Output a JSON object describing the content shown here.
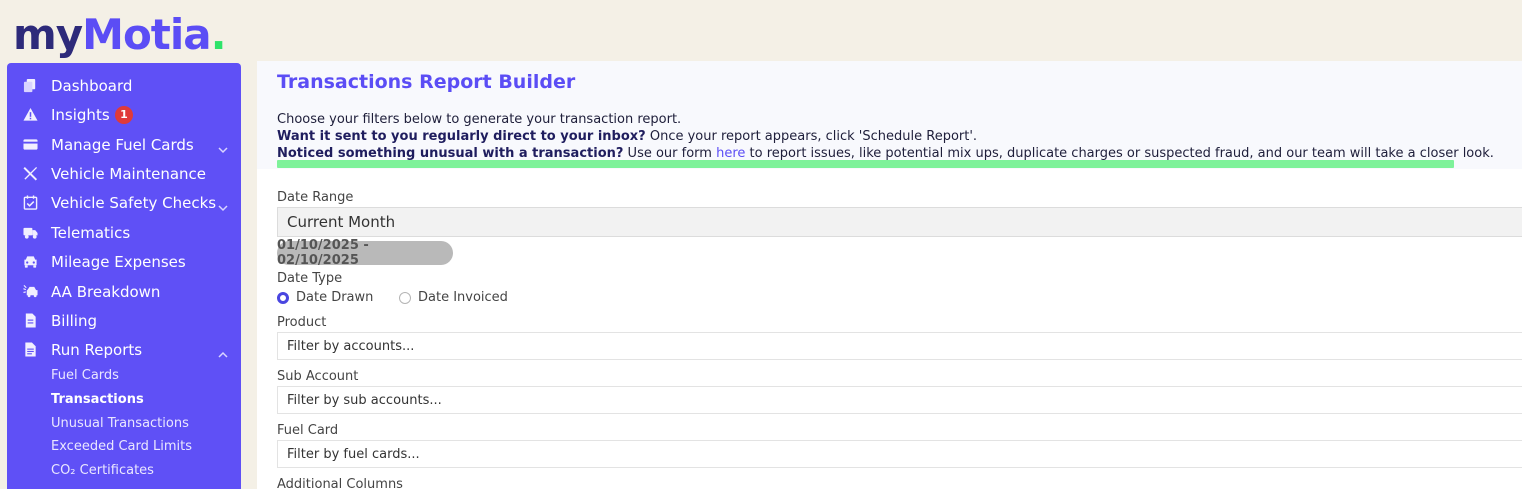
{
  "brand": {
    "logo_prefix": "my",
    "logo_main": "Motia",
    "logo_dot": "."
  },
  "sidebar": {
    "items": [
      {
        "label": "Dashboard",
        "icon": "copy-icon"
      },
      {
        "label": "Insights",
        "icon": "warning-icon",
        "badge": "1"
      },
      {
        "label": "Manage Fuel Cards",
        "icon": "credit-card-icon",
        "expandable": true
      },
      {
        "label": "Vehicle Maintenance",
        "icon": "tools-icon"
      },
      {
        "label": "Vehicle Safety Checks",
        "icon": "calendar-check-icon",
        "expandable": true
      },
      {
        "label": "Telematics",
        "icon": "truck-icon"
      },
      {
        "label": "Mileage Expenses",
        "icon": "car-icon"
      },
      {
        "label": "AA Breakdown",
        "icon": "car-crash-icon"
      },
      {
        "label": "Billing",
        "icon": "invoice-icon"
      },
      {
        "label": "Run Reports",
        "icon": "report-icon",
        "expanded": true
      }
    ],
    "report_subitems": [
      {
        "label": "Fuel Cards"
      },
      {
        "label": "Transactions",
        "active": true
      },
      {
        "label": "Unusual Transactions"
      },
      {
        "label": "Exceeded Card Limits"
      },
      {
        "label": "CO₂ Certificates"
      }
    ]
  },
  "main": {
    "title": "Transactions Report Builder",
    "intro": "Choose your filters below to generate your transaction report.",
    "schedule_bold": "Want it sent to you regularly direct to your inbox?",
    "schedule_text": " Once your report appears, click 'Schedule Report'.",
    "unusual_bold": "Noticed something unusual with a transaction?",
    "unusual_text_before": " Use our form ",
    "unusual_link": "here",
    "unusual_text_after": " to report issues, like potential mix ups, duplicate charges or suspected fraud, and our team will take a closer look.",
    "date_range_label": "Date Range",
    "date_range_value": "Current Month",
    "date_range_display": "01/10/2025 - 02/10/2025",
    "date_type_label": "Date Type",
    "date_type_options": [
      {
        "label": "Date Drawn",
        "selected": true
      },
      {
        "label": "Date Invoiced",
        "selected": false
      }
    ],
    "product_label": "Product",
    "product_placeholder": "Filter by accounts...",
    "sub_account_label": "Sub Account",
    "sub_account_placeholder": "Filter by sub accounts...",
    "fuel_card_label": "Fuel Card",
    "fuel_card_placeholder": "Filter by fuel cards...",
    "additional_columns_label": "Additional Columns"
  },
  "colors": {
    "accent": "#5b4df5",
    "sidebar": "#5f50f6",
    "highlight": "#7ef29a",
    "badge": "#e03a3a"
  }
}
